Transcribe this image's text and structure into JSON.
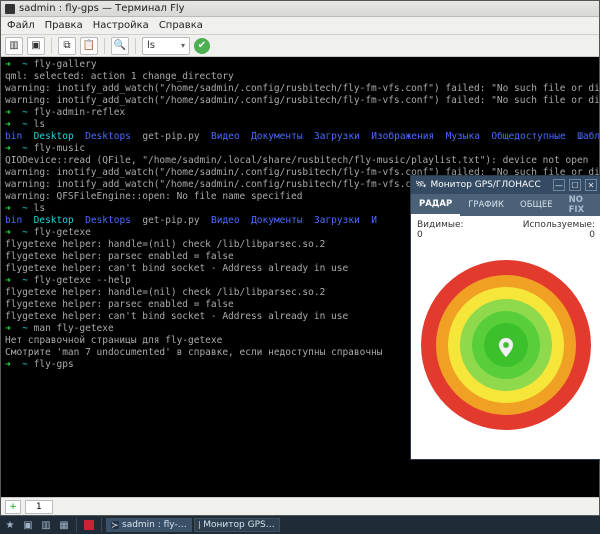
{
  "terminal": {
    "title": "sadmin : fly-gps — Терминал Fly",
    "menu": [
      "Файл",
      "Правка",
      "Настройка",
      "Справка"
    ],
    "toolbar": {
      "select_value": "ls"
    },
    "tab": {
      "label": "1"
    },
    "prompt": "➜  ~",
    "lines": [
      {
        "segs": [
          {
            "t": "➜  ",
            "c": "green"
          },
          {
            "t": "~ ",
            "c": "cyan"
          },
          {
            "t": "fly-gallery",
            "c": "gray"
          }
        ]
      },
      {
        "segs": [
          {
            "t": "qml: selected: action 1 change_directory",
            "c": "gray"
          }
        ]
      },
      {
        "segs": [
          {
            "t": "warning: inotify_add_watch(\"/home/sadmin/.config/rusbitech/fly-fm-vfs.conf\") failed: \"No such file or directory\"",
            "c": "gray"
          }
        ]
      },
      {
        "segs": [
          {
            "t": "warning: inotify_add_watch(\"/home/sadmin/.config/rusbitech/fly-fm-vfs.conf\") failed: \"No such file or directory\"",
            "c": "gray"
          }
        ]
      },
      {
        "segs": [
          {
            "t": "➜  ",
            "c": "green"
          },
          {
            "t": "~ ",
            "c": "cyan"
          },
          {
            "t": "fly-admin-reflex",
            "c": "gray"
          }
        ]
      },
      {
        "segs": [
          {
            "t": "➜  ",
            "c": "green"
          },
          {
            "t": "~ ",
            "c": "cyan"
          },
          {
            "t": "ls",
            "c": "gray"
          }
        ]
      },
      {
        "segs": [
          {
            "t": "bin",
            "c": "blue"
          },
          {
            "t": "  ",
            "c": "gray"
          },
          {
            "t": "Desktop",
            "c": "cyan"
          },
          {
            "t": "  ",
            "c": "gray"
          },
          {
            "t": "Desktops",
            "c": "blue"
          },
          {
            "t": "  ",
            "c": "gray"
          },
          {
            "t": "get-pip.py",
            "c": "gray"
          },
          {
            "t": "  ",
            "c": "gray"
          },
          {
            "t": "Видео",
            "c": "blue"
          },
          {
            "t": "  ",
            "c": "gray"
          },
          {
            "t": "Документы",
            "c": "blue"
          },
          {
            "t": "  ",
            "c": "gray"
          },
          {
            "t": "Загрузки",
            "c": "blue"
          },
          {
            "t": "  ",
            "c": "gray"
          },
          {
            "t": "Изображения",
            "c": "blue"
          },
          {
            "t": "  ",
            "c": "gray"
          },
          {
            "t": "Музыка",
            "c": "blue"
          },
          {
            "t": "  ",
            "c": "gray"
          },
          {
            "t": "Общедоступные",
            "c": "blue"
          },
          {
            "t": "  ",
            "c": "gray"
          },
          {
            "t": "Шаблоны",
            "c": "blue"
          }
        ]
      },
      {
        "segs": [
          {
            "t": "➜  ",
            "c": "green"
          },
          {
            "t": "~ ",
            "c": "cyan"
          },
          {
            "t": "fly-music",
            "c": "gray"
          }
        ]
      },
      {
        "segs": [
          {
            "t": "QIODevice::read (QFile, \"/home/sadmin/.local/share/rusbitech/fly-music/playlist.txt\"): device not open",
            "c": "gray"
          }
        ]
      },
      {
        "segs": [
          {
            "t": "warning: inotify_add_watch(\"/home/sadmin/.config/rusbitech/fly-fm-vfs.conf\") failed: \"No such file or directory\"",
            "c": "gray"
          }
        ]
      },
      {
        "segs": [
          {
            "t": "warning: inotify_add_watch(\"/home/sadmin/.config/rusbitech/fly-fm-vfs.conf\") failed: \"No such file or directory\"",
            "c": "gray"
          }
        ]
      },
      {
        "segs": [
          {
            "t": "warning: QFSFileEngine::open: No file name specified",
            "c": "gray"
          }
        ]
      },
      {
        "segs": [
          {
            "t": "➜  ",
            "c": "green"
          },
          {
            "t": "~ ",
            "c": "cyan"
          },
          {
            "t": "ls",
            "c": "gray"
          }
        ]
      },
      {
        "segs": [
          {
            "t": "bin",
            "c": "blue"
          },
          {
            "t": "  ",
            "c": "gray"
          },
          {
            "t": "Desktop",
            "c": "cyan"
          },
          {
            "t": "  ",
            "c": "gray"
          },
          {
            "t": "Desktops",
            "c": "blue"
          },
          {
            "t": "  ",
            "c": "gray"
          },
          {
            "t": "get-pip.py",
            "c": "gray"
          },
          {
            "t": "  ",
            "c": "gray"
          },
          {
            "t": "Видео",
            "c": "blue"
          },
          {
            "t": "  ",
            "c": "gray"
          },
          {
            "t": "Документы",
            "c": "blue"
          },
          {
            "t": "  ",
            "c": "gray"
          },
          {
            "t": "Загрузки",
            "c": "blue"
          },
          {
            "t": "  ",
            "c": "gray"
          },
          {
            "t": "И",
            "c": "blue"
          }
        ]
      },
      {
        "segs": [
          {
            "t": "➜  ",
            "c": "green"
          },
          {
            "t": "~ ",
            "c": "cyan"
          },
          {
            "t": "fly-getexe",
            "c": "gray"
          }
        ]
      },
      {
        "segs": [
          {
            "t": "flygetexe helper: handle=(nil) check /lib/libparsec.so.2",
            "c": "gray"
          }
        ]
      },
      {
        "segs": [
          {
            "t": "flygetexe helper: parsec enabled = false",
            "c": "gray"
          }
        ]
      },
      {
        "segs": [
          {
            "t": "flygetexe helper: can't bind socket - Address already in use",
            "c": "gray"
          }
        ]
      },
      {
        "segs": [
          {
            "t": "➜  ",
            "c": "green"
          },
          {
            "t": "~ ",
            "c": "cyan"
          },
          {
            "t": "fly-getexe --help",
            "c": "gray"
          }
        ]
      },
      {
        "segs": [
          {
            "t": "flygetexe helper: handle=(nil) check /lib/libparsec.so.2",
            "c": "gray"
          }
        ]
      },
      {
        "segs": [
          {
            "t": "flygetexe helper: parsec enabled = false",
            "c": "gray"
          }
        ]
      },
      {
        "segs": [
          {
            "t": "flygetexe helper: can't bind socket - Address already in use",
            "c": "gray"
          }
        ]
      },
      {
        "segs": [
          {
            "t": "➜  ",
            "c": "green"
          },
          {
            "t": "~ ",
            "c": "cyan"
          },
          {
            "t": "man fly-getexe",
            "c": "gray"
          }
        ]
      },
      {
        "segs": [
          {
            "t": "Нет справочной страницы для fly-getexe",
            "c": "gray"
          }
        ]
      },
      {
        "segs": [
          {
            "t": "Смотрите 'man 7 undocumented' в справке, если недоступны справочны",
            "c": "gray"
          }
        ]
      },
      {
        "segs": [
          {
            "t": "➜  ",
            "c": "green"
          },
          {
            "t": "~ ",
            "c": "cyan"
          },
          {
            "t": "fly-gps",
            "c": "gray"
          }
        ]
      }
    ]
  },
  "gps": {
    "title": "Монитор GPS/ГЛОНАСС",
    "tabs": [
      "РАДАР",
      "ГРАФИК",
      "ОБЩЕЕ"
    ],
    "status": "NO FIX",
    "visible_label": "Видимые:",
    "used_label": "Используемые:",
    "visible_value": "0",
    "used_value": "0",
    "rings": [
      {
        "r": 85,
        "fill": "#e23b2e"
      },
      {
        "r": 70,
        "fill": "#f0a022"
      },
      {
        "r": 58,
        "fill": "#f6e63a"
      },
      {
        "r": 46,
        "fill": "#8fd94d"
      },
      {
        "r": 34,
        "fill": "#58cf3a"
      },
      {
        "r": 22,
        "fill": "#3cc12c"
      }
    ]
  },
  "taskbar": {
    "tasks": [
      {
        "label": "sadmin : fly-…",
        "color": "#253445"
      },
      {
        "label": "Монитор GPS…",
        "color": "#f0a022"
      }
    ]
  }
}
